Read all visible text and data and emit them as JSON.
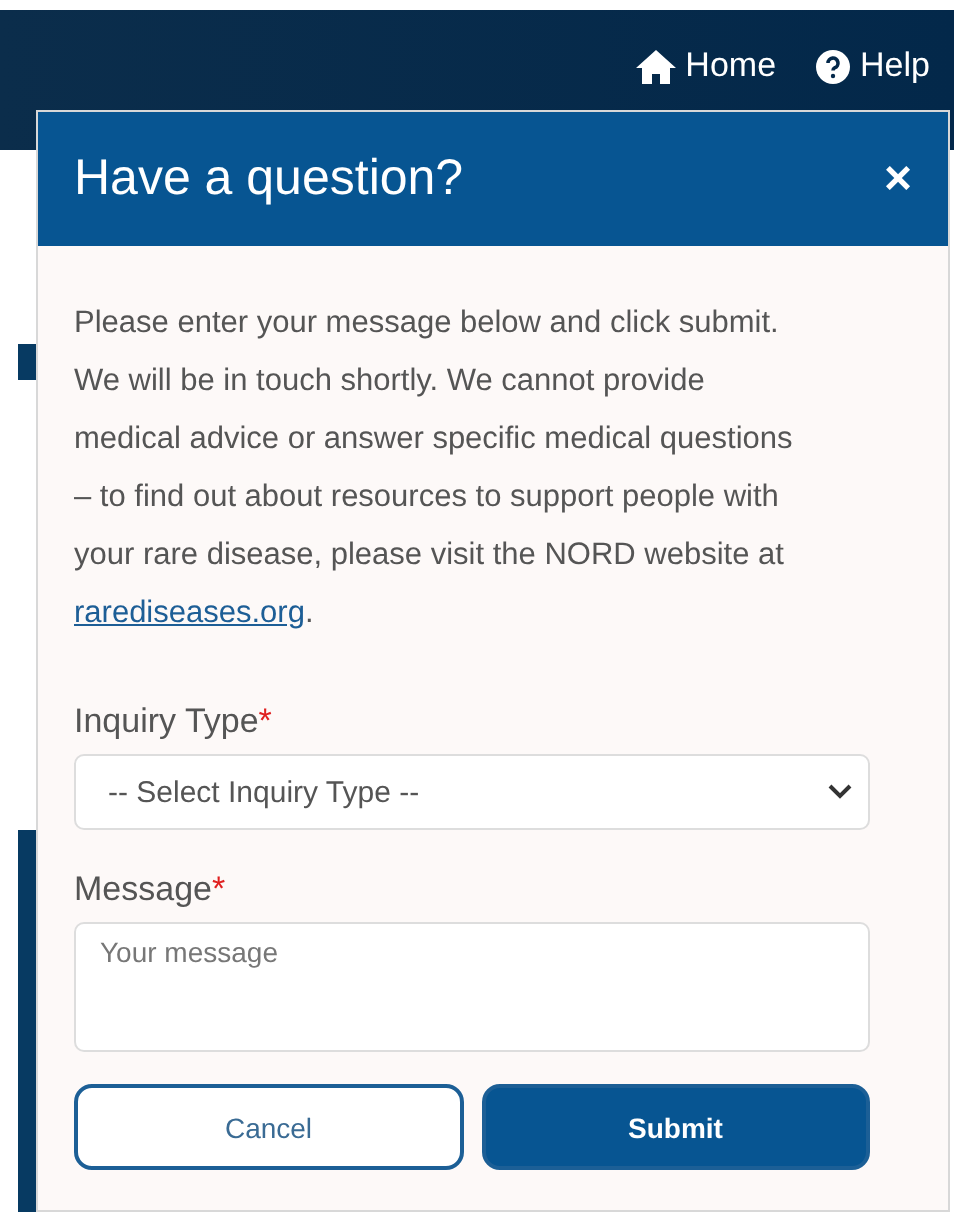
{
  "nav": {
    "links": [
      {
        "kind": "home",
        "label": "Home"
      },
      {
        "kind": "help",
        "label": "Help"
      }
    ]
  },
  "dialog": {
    "title": "Have a question?",
    "close": "×",
    "intro": "Please enter your message below and click submit. We will be in touch shortly. We cannot provide medical advice or answer specific medical questions – to find out about resources to support people with your rare disease, please visit the NORD website at ",
    "link": "rarediseases.org",
    "intro_end": ".",
    "fields": [
      {
        "kind": "select",
        "label": "Inquiry Type",
        "required_mark": "*",
        "value": "-- Select Inquiry Type --"
      },
      {
        "kind": "textarea",
        "label": "Message",
        "required_mark": "*",
        "placeholder": "Your message"
      }
    ],
    "buttons": [
      {
        "kind": "secondary",
        "label": "Cancel"
      },
      {
        "kind": "primary",
        "label": "Submit"
      }
    ]
  }
}
